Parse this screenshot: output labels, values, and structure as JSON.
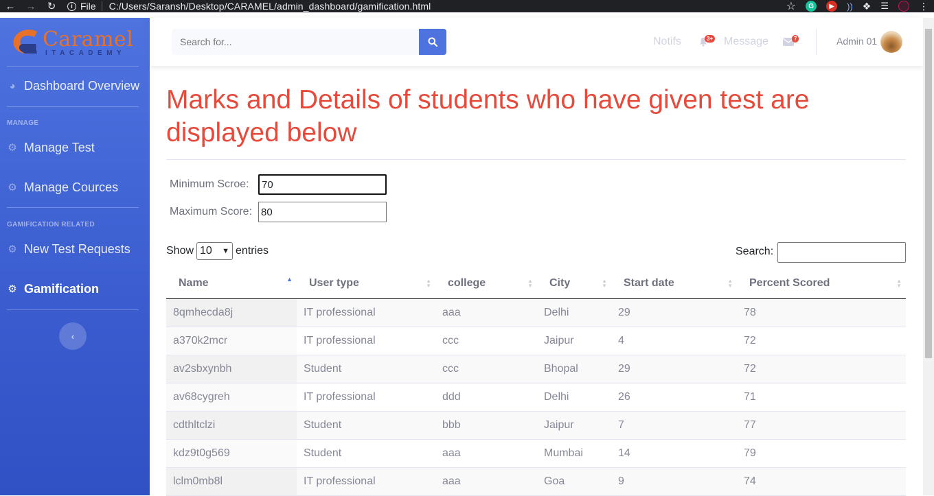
{
  "browser": {
    "file_label": "File",
    "url": "C:/Users/Saransh/Desktop/CARAMEL/admin_dashboard/gamification.html"
  },
  "brand": {
    "name": "Caramel",
    "subtitle": "ITACADEMY"
  },
  "sidebar": {
    "overview": "Dashboard Overview",
    "heading_manage": "MANAGE",
    "manage_test": "Manage Test",
    "manage_cources": "Manage Cources",
    "heading_gamification": "GAMIFICATION RELATED",
    "new_test_requests": "New Test Requests",
    "gamification": "Gamification"
  },
  "topbar": {
    "search_placeholder": "Search for...",
    "notifs_label": "Notifs",
    "notifs_badge": "3+",
    "message_label": "Message",
    "message_badge": "7",
    "admin_name": "Admin 01"
  },
  "page": {
    "title": "Marks and Details of students who have given test are displayed below"
  },
  "filters": {
    "min_label": "Minimum Scroe:",
    "min_value": "70",
    "max_label": "Maximum Score:",
    "max_value": "80"
  },
  "datatable": {
    "show_label": "Show",
    "entries_value": "10",
    "entries_label": "entries",
    "search_label": "Search:",
    "columns": [
      "Name",
      "User type",
      "college",
      "City",
      "Start date",
      "Percent Scored"
    ],
    "rows": [
      [
        "8qmhecda8j",
        "IT professional",
        "aaa",
        "Delhi",
        "29",
        "78"
      ],
      [
        "a370k2mcr",
        "IT professional",
        "ccc",
        "Jaipur",
        "4",
        "72"
      ],
      [
        "av2sbxynbh",
        "Student",
        "ccc",
        "Bhopal",
        "29",
        "72"
      ],
      [
        "av68cygreh",
        "IT professional",
        "ddd",
        "Delhi",
        "26",
        "71"
      ],
      [
        "cdthltclzi",
        "Student",
        "bbb",
        "Jaipur",
        "7",
        "77"
      ],
      [
        "kdz9t0g569",
        "Student",
        "aaa",
        "Mumbai",
        "14",
        "79"
      ],
      [
        "lclm0mb8l",
        "IT professional",
        "aaa",
        "Goa",
        "9",
        "74"
      ]
    ]
  }
}
